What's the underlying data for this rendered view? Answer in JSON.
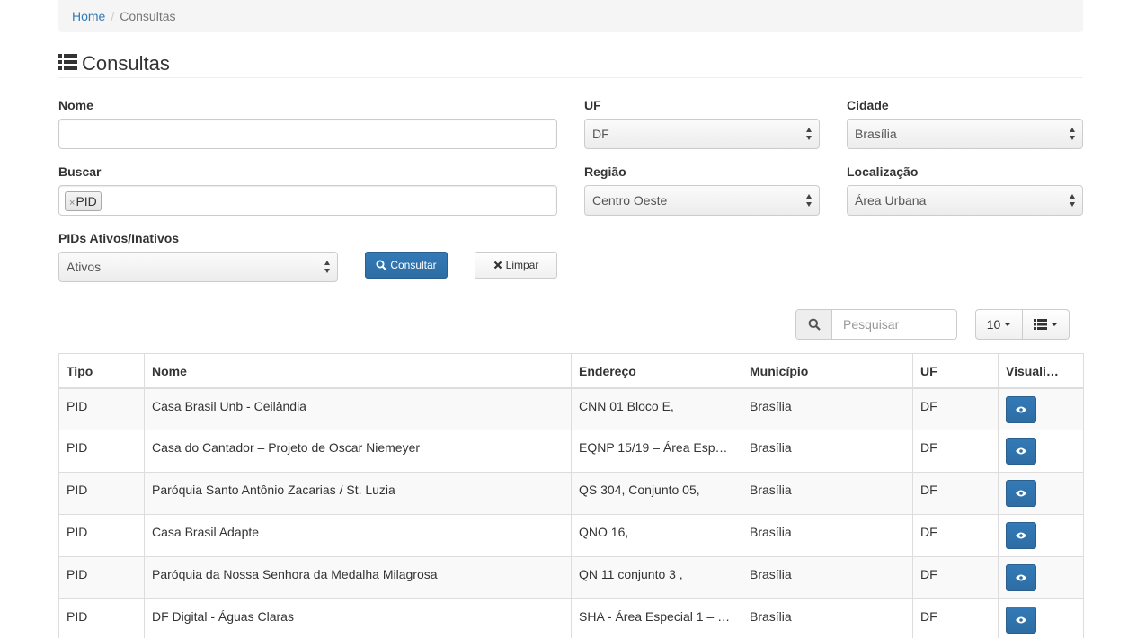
{
  "breadcrumb": {
    "home": "Home",
    "separator": "/",
    "current": "Consultas"
  },
  "page": {
    "title": "Consultas",
    "title_icon": "list-icon"
  },
  "filters": {
    "nome": {
      "label": "Nome",
      "value": ""
    },
    "uf": {
      "label": "UF",
      "value": "DF"
    },
    "cidade": {
      "label": "Cidade",
      "value": "Brasília"
    },
    "buscar": {
      "label": "Buscar",
      "tags": [
        "PID"
      ],
      "tag_remove": "×"
    },
    "regiao": {
      "label": "Região",
      "value": "Centro Oeste"
    },
    "localizacao": {
      "label": "Localização",
      "value": "Área Urbana"
    },
    "pids": {
      "label": "PIDs Ativos/Inativos",
      "value": "Ativos"
    }
  },
  "actions": {
    "consultar": "Consultar",
    "limpar": "Limpar"
  },
  "table_toolbar": {
    "search_placeholder": "Pesquisar",
    "page_size": "10"
  },
  "table": {
    "columns": [
      "Tipo",
      "Nome",
      "Endereço",
      "Município",
      "UF",
      "Visuali…"
    ],
    "rows": [
      [
        "PID",
        "Casa Brasil Unb - Ceilândia",
        "CNN 01 Bloco E,",
        "Brasília",
        "DF"
      ],
      [
        "PID",
        "Casa do Cantador – Projeto de Oscar Niemeyer",
        "EQNP 15/19 – Área Espe…",
        "Brasília",
        "DF"
      ],
      [
        "PID",
        "Paróquia Santo Antônio Zacarias / St. Luzia",
        "QS 304, Conjunto 05,",
        "Brasília",
        "DF"
      ],
      [
        "PID",
        "Casa Brasil Adapte",
        "QNO 16,",
        "Brasília",
        "DF"
      ],
      [
        "PID",
        "Paróquia da Nossa Senhora da Medalha Milagrosa",
        "QN 11 conjunto 3 ,",
        "Brasília",
        "DF"
      ],
      [
        "PID",
        "DF Digital - Águas Claras",
        "SHA - Área Especial 1 – …",
        "Brasília",
        "DF"
      ]
    ]
  },
  "colors": {
    "primary": "#337ab7",
    "link": "#337ab7",
    "border": "#dddddd"
  }
}
